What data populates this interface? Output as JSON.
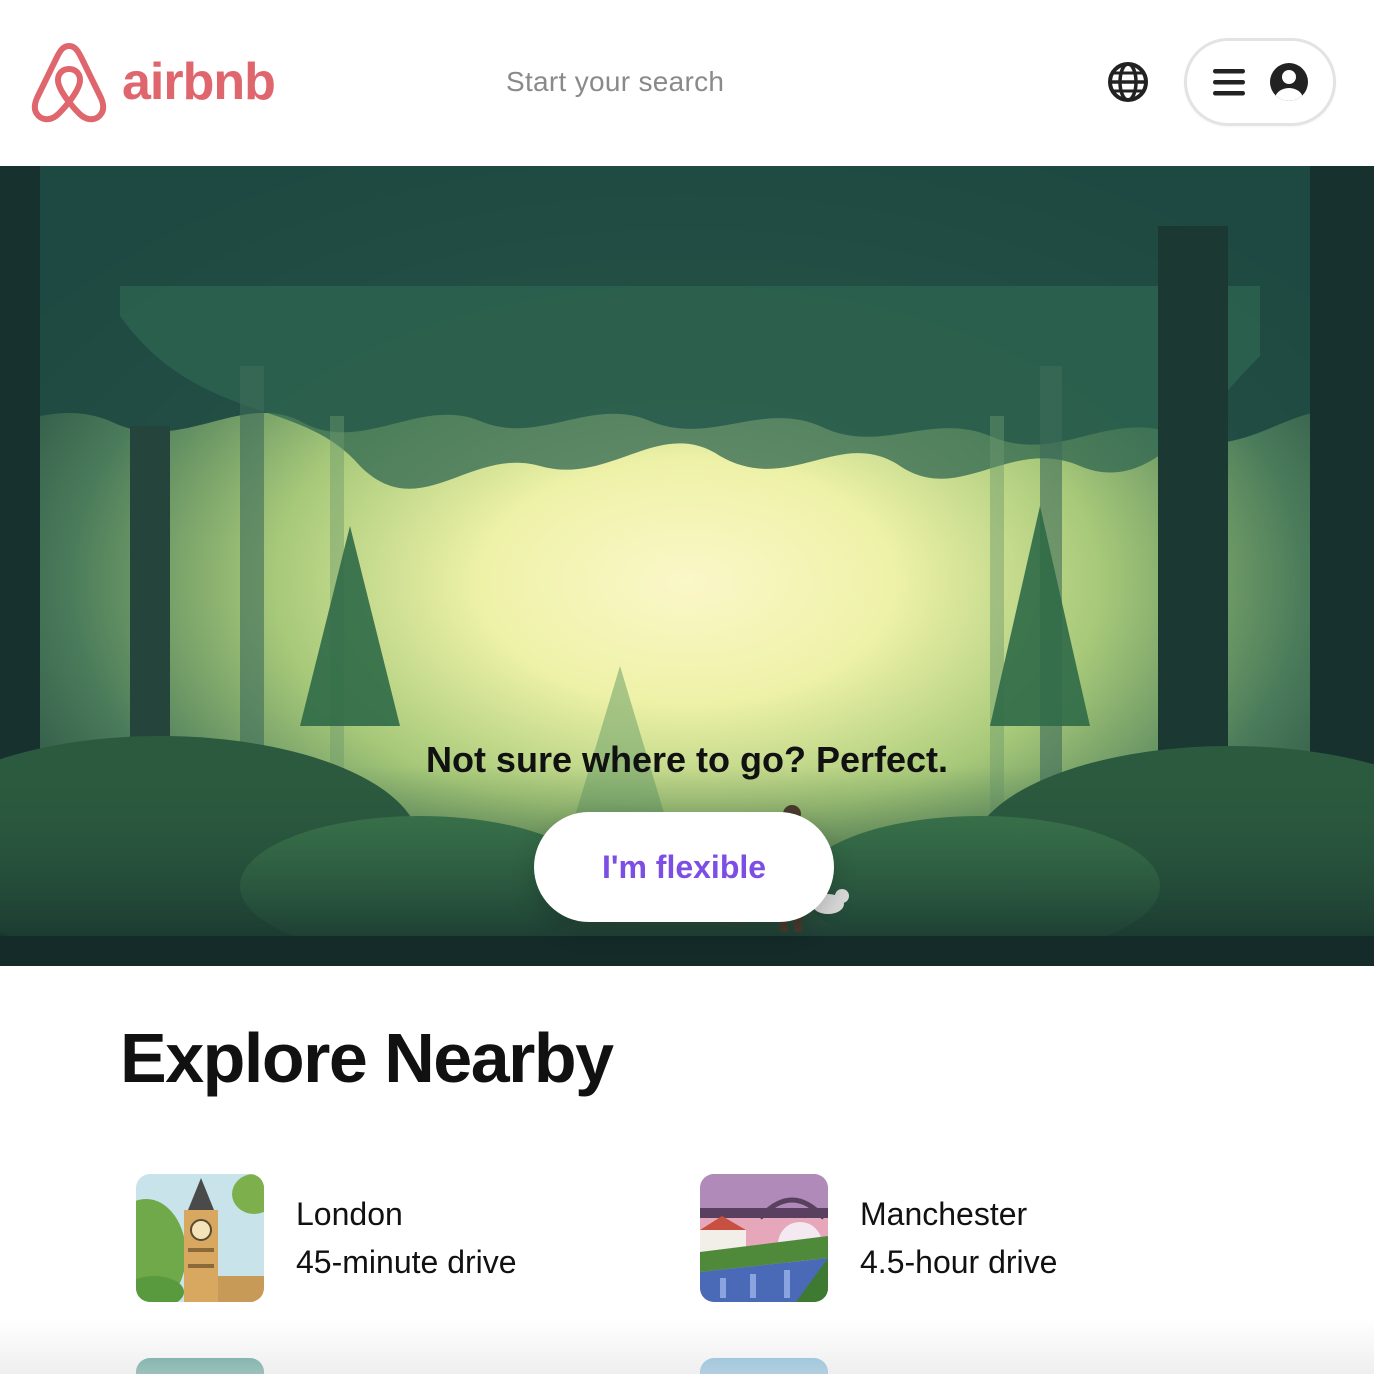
{
  "header": {
    "logo_text": "airbnb",
    "search_placeholder": "Start your search",
    "icons": [
      "airbnb-logo-icon",
      "globe-icon",
      "hamburger-menu-icon",
      "user-avatar-icon"
    ]
  },
  "hero": {
    "title": "Not sure where to go? Perfect.",
    "button_label": "I'm flexible"
  },
  "explore": {
    "title": "Explore Nearby",
    "items": [
      {
        "city": "London",
        "drive": "45-minute drive"
      },
      {
        "city": "Manchester",
        "drive": "4.5-hour drive"
      }
    ]
  },
  "colors": {
    "brand": "#e0666e",
    "accent_button_text": "#7c4ee3",
    "icon": "#222222",
    "muted_text": "#8a8a8a"
  }
}
